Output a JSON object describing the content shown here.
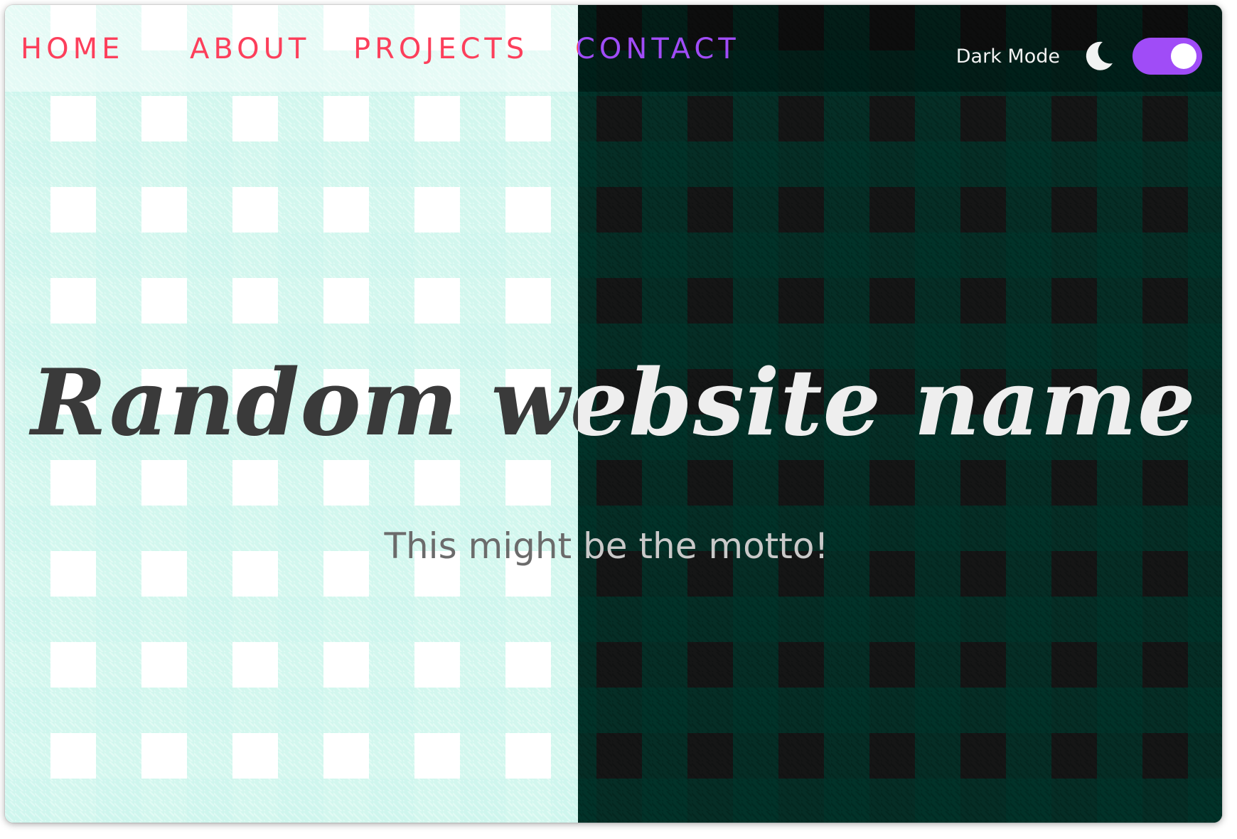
{
  "nav": {
    "items": [
      {
        "label": "HOME"
      },
      {
        "label": "ABOUT"
      },
      {
        "label": "PROJECTS"
      },
      {
        "label": "CONTACT"
      }
    ]
  },
  "hero": {
    "title": "Random website name",
    "motto": "This might be the motto!"
  },
  "dark_mode": {
    "label": "Dark Mode",
    "icon": "moon-icon",
    "enabled": true
  },
  "colors": {
    "nav_link_light": "#fc3f5b",
    "nav_link_dark": "#a04cf7",
    "toggle_on": "#a04cf7",
    "checker_light": "#cef6ed",
    "checker_dark": "#00342a",
    "background_dark": "#151616"
  }
}
